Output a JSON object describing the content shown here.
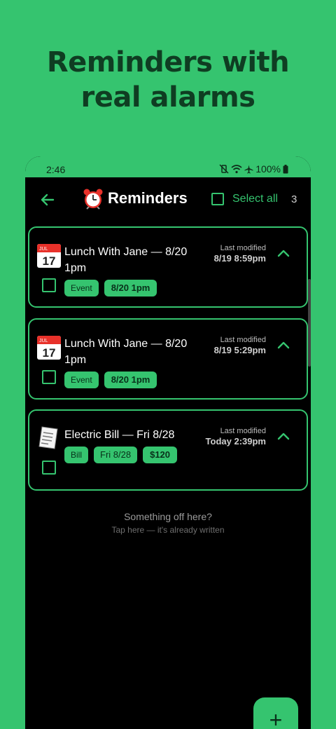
{
  "headline": {
    "line1": "Reminders with",
    "line2": "real alarms"
  },
  "statusbar": {
    "time": "2:46",
    "battery": "100%"
  },
  "appbar": {
    "back_icon": "arrow-left-icon",
    "title_icon": "alarm-clock-icon",
    "title": "Reminders",
    "select_all_label": "Select all",
    "count": "3"
  },
  "cards": [
    {
      "icon": "calendar-icon",
      "calendar_month": "JUL",
      "calendar_day": "17",
      "title": "Lunch With Jane — 8/20 1pm",
      "modified_label": "Last modified",
      "modified_value": "8/19 8:59pm",
      "chips": [
        "Event",
        "8/20 1pm"
      ]
    },
    {
      "icon": "calendar-icon",
      "calendar_month": "JUL",
      "calendar_day": "17",
      "title": "Lunch With Jane — 8/20 1pm",
      "modified_label": "Last modified",
      "modified_value": "8/19 5:29pm",
      "chips": [
        "Event",
        "8/20 1pm"
      ]
    },
    {
      "icon": "receipt-icon",
      "title": "Electric Bill — Fri 8/28",
      "modified_label": "Last modified",
      "modified_value": "Today 2:39pm",
      "chips": [
        "Bill",
        "Fri 8/28",
        "$120"
      ]
    }
  ],
  "empty_state": {
    "title": "Something off here?",
    "subtitle": "Tap here — it's already written"
  },
  "fab": {
    "label": "+"
  },
  "colors": {
    "accent": "#35c46f",
    "background": "#000000",
    "headline": "#0f3d22"
  }
}
